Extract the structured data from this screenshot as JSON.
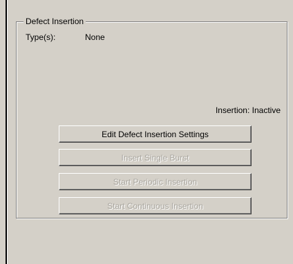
{
  "group": {
    "title": "Defect Insertion",
    "types_label": "Type(s):",
    "types_value": "None",
    "status_label": "Insertion:",
    "status_value": "Inactive"
  },
  "buttons": {
    "edit_settings": "Edit Defect Insertion Settings",
    "insert_single_burst": "Insert Single Burst",
    "start_periodic": "Start Periodic Insertion",
    "start_continuous": "Start Continuous Insertion"
  }
}
